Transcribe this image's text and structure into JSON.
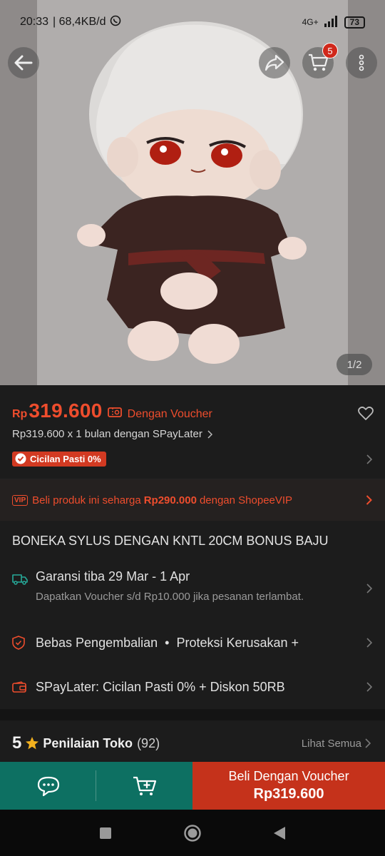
{
  "status_bar": {
    "time": "20:33",
    "speed": "| 68,4KB/d",
    "network": "4G+",
    "battery": "73"
  },
  "gallery": {
    "counter": "1/2",
    "cart_badge": "5"
  },
  "price": {
    "currency": "Rp",
    "value": "319.600",
    "voucher_label": "Dengan Voucher",
    "spaylater": "Rp319.600 x 1 bulan dengan SPayLater",
    "cicilan_badge": "Cicilan Pasti 0%"
  },
  "vip": {
    "tag": "VIP",
    "text_before": "Beli produk ini seharga",
    "price": "Rp290.000",
    "text_after": "dengan ShopeeVIP"
  },
  "product": {
    "title": "BONEKA SYLUS DENGAN KNTL 20CM BONUS BAJU"
  },
  "shipping": {
    "title": "Garansi tiba 29 Mar - 1 Apr",
    "subtitle": "Dapatkan Voucher s/d Rp10.000 jika pesanan terlambat."
  },
  "protection": {
    "label": "Bebas Pengembalian",
    "separator": "•",
    "extra": "Proteksi Kerusakan +"
  },
  "spaylater_promo": {
    "label": "SPayLater: Cicilan Pasti 0% + Diskon 50RB"
  },
  "rating": {
    "score": "5",
    "label": "Penilaian Toko",
    "count": "(92)",
    "see_all": "Lihat Semua"
  },
  "action_bar": {
    "buy_label": "Beli Dengan Voucher",
    "buy_price": "Rp319.600"
  },
  "colors": {
    "accent": "#ee4d2d",
    "buy": "#c5321b",
    "teal": "#0d7062"
  }
}
